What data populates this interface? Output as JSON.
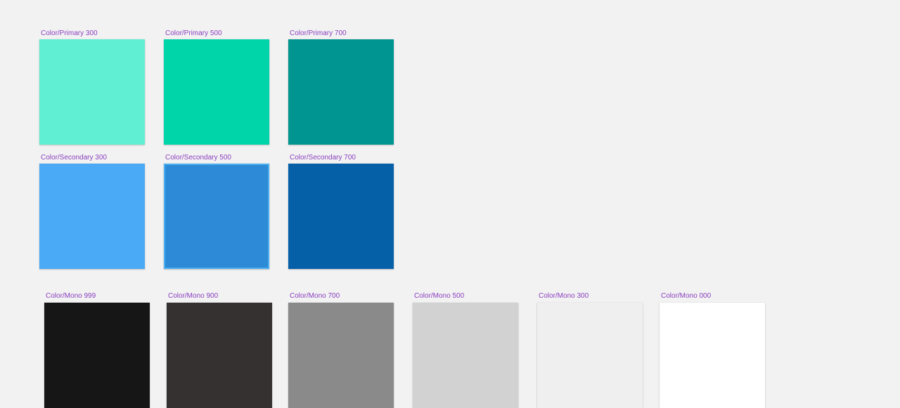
{
  "swatches": [
    {
      "label": "Color/Primary 300",
      "color": "#60efd2"
    },
    {
      "label": "Color/Primary 500",
      "color": "#00d4a9"
    },
    {
      "label": "Color/Primary 700",
      "color": "#009590"
    },
    {
      "label": "Color/Secondary 300",
      "color": "#4baaf5"
    },
    {
      "label": "Color/Secondary 500",
      "color": "#2c8ad6",
      "selected": true
    },
    {
      "label": "Color/Secondary 700",
      "color": "#0660a8"
    },
    {
      "label": "Color/Mono 999",
      "color": "#161616"
    },
    {
      "label": "Color/Mono 900",
      "color": "#353130"
    },
    {
      "label": "Color/Mono 700",
      "color": "#8a8a8a"
    },
    {
      "label": "Color/Mono 500",
      "color": "#d2d2d2"
    },
    {
      "label": "Color/Mono 300",
      "color": "#efefef"
    },
    {
      "label": "Color/Mono 000",
      "color": "#ffffff"
    }
  ],
  "colors": {
    "canvas_background": "#f2f2f2",
    "label_color": "#8a3fbf",
    "selection_outline": "#4aaef0"
  }
}
